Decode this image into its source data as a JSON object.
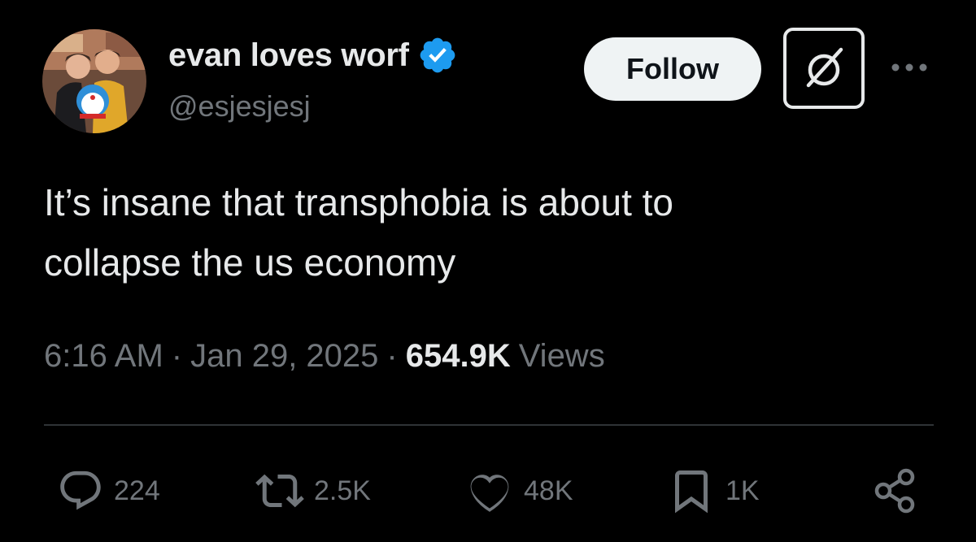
{
  "author": {
    "display_name": "evan loves worf",
    "handle": "@esjesjesj",
    "verified": true
  },
  "header": {
    "follow_label": "Follow"
  },
  "tweet": {
    "text": "It’s insane that transphobia is about to\ncollapse the us economy",
    "time": "6:16 AM",
    "separator": "·",
    "date": "Jan 29, 2025",
    "views_count": "654.9K",
    "views_label": "Views"
  },
  "actions": {
    "replies": "224",
    "reposts": "2.5K",
    "likes": "48K",
    "bookmarks": "1K"
  },
  "icons": {
    "verified": "verified-badge-icon",
    "grok": "grok-icon",
    "more": "more-horizontal-icon",
    "reply": "reply-icon",
    "repost": "repost-icon",
    "like": "heart-icon",
    "bookmark": "bookmark-icon",
    "share": "share-icon"
  },
  "colors": {
    "background": "#000000",
    "text_primary": "#e7e9ea",
    "text_secondary": "#71767b",
    "verified_blue": "#1d9bf0",
    "follow_bg": "#eff3f4",
    "divider": "#2f3336"
  }
}
